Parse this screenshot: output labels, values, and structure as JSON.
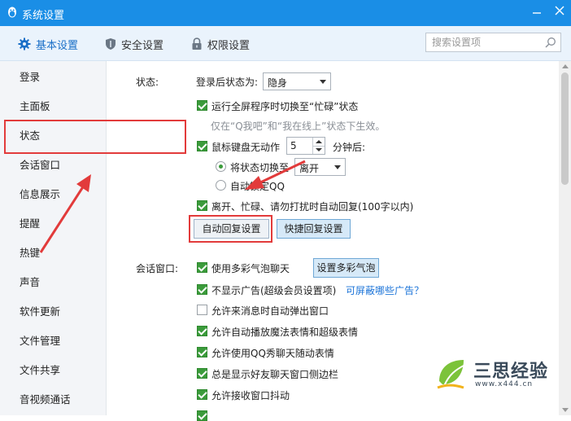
{
  "window": {
    "title": "系统设置"
  },
  "tabs": [
    {
      "label": "基本设置",
      "active": true
    },
    {
      "label": "安全设置",
      "active": false
    },
    {
      "label": "权限设置",
      "active": false
    }
  ],
  "search": {
    "placeholder": "搜索设置项"
  },
  "sidebar": {
    "items": [
      "登录",
      "主面板",
      "状态",
      "会话窗口",
      "信息展示",
      "提醒",
      "热键",
      "声音",
      "软件更新",
      "文件管理",
      "文件共享",
      "音视频通话"
    ],
    "selected": "状态"
  },
  "status_section": {
    "label": "状态:",
    "after_login_label": "登录后状态为:",
    "after_login_value": "隐身",
    "fullscreen_busy": {
      "label": "运行全屏程序时切换至“忙碌”状态",
      "checked": true
    },
    "fullscreen_hint": "仅在“Q我吧”和“我在线上”状态下生效。",
    "idle": {
      "label": "鼠标键盘无动作",
      "checked": true,
      "minutes": "5",
      "suffix": "分钟后:"
    },
    "idle_switch": {
      "label": "将状态切换至",
      "value": "离开",
      "selected": true
    },
    "idle_lock": {
      "label": "自动锁定QQ",
      "selected": false
    },
    "auto_reply": {
      "label": "离开、忙碌、请勿打扰时自动回复(100字以内)",
      "checked": true
    },
    "auto_reply_button": "自动回复设置",
    "quick_reply_button": "快捷回复设置"
  },
  "chat_section": {
    "label": "会话窗口:",
    "options": [
      {
        "label": "使用多彩气泡聊天",
        "checked": true
      },
      {
        "label": "不显示广告(超级会员设置项)",
        "checked": true
      },
      {
        "label": "允许来消息时自动弹出窗口",
        "checked": false
      },
      {
        "label": "允许自动播放魔法表情和超级表情",
        "checked": true
      },
      {
        "label": "允许使用QQ秀聊天随动表情",
        "checked": true
      },
      {
        "label": "总是显示好友聊天窗口侧边栏",
        "checked": true
      },
      {
        "label": "允许接收窗口抖动",
        "checked": true
      }
    ],
    "bubble_button": "设置多彩气泡",
    "ad_link": "可屏蔽哪些广告？"
  },
  "watermark": {
    "text": "三思经验",
    "url": "www.x444.cn"
  },
  "colors": {
    "titlebar": "#1a8ee6",
    "accent": "#1a6fc7",
    "check": "#3b9b3b",
    "annotation": "#e23b3b"
  }
}
